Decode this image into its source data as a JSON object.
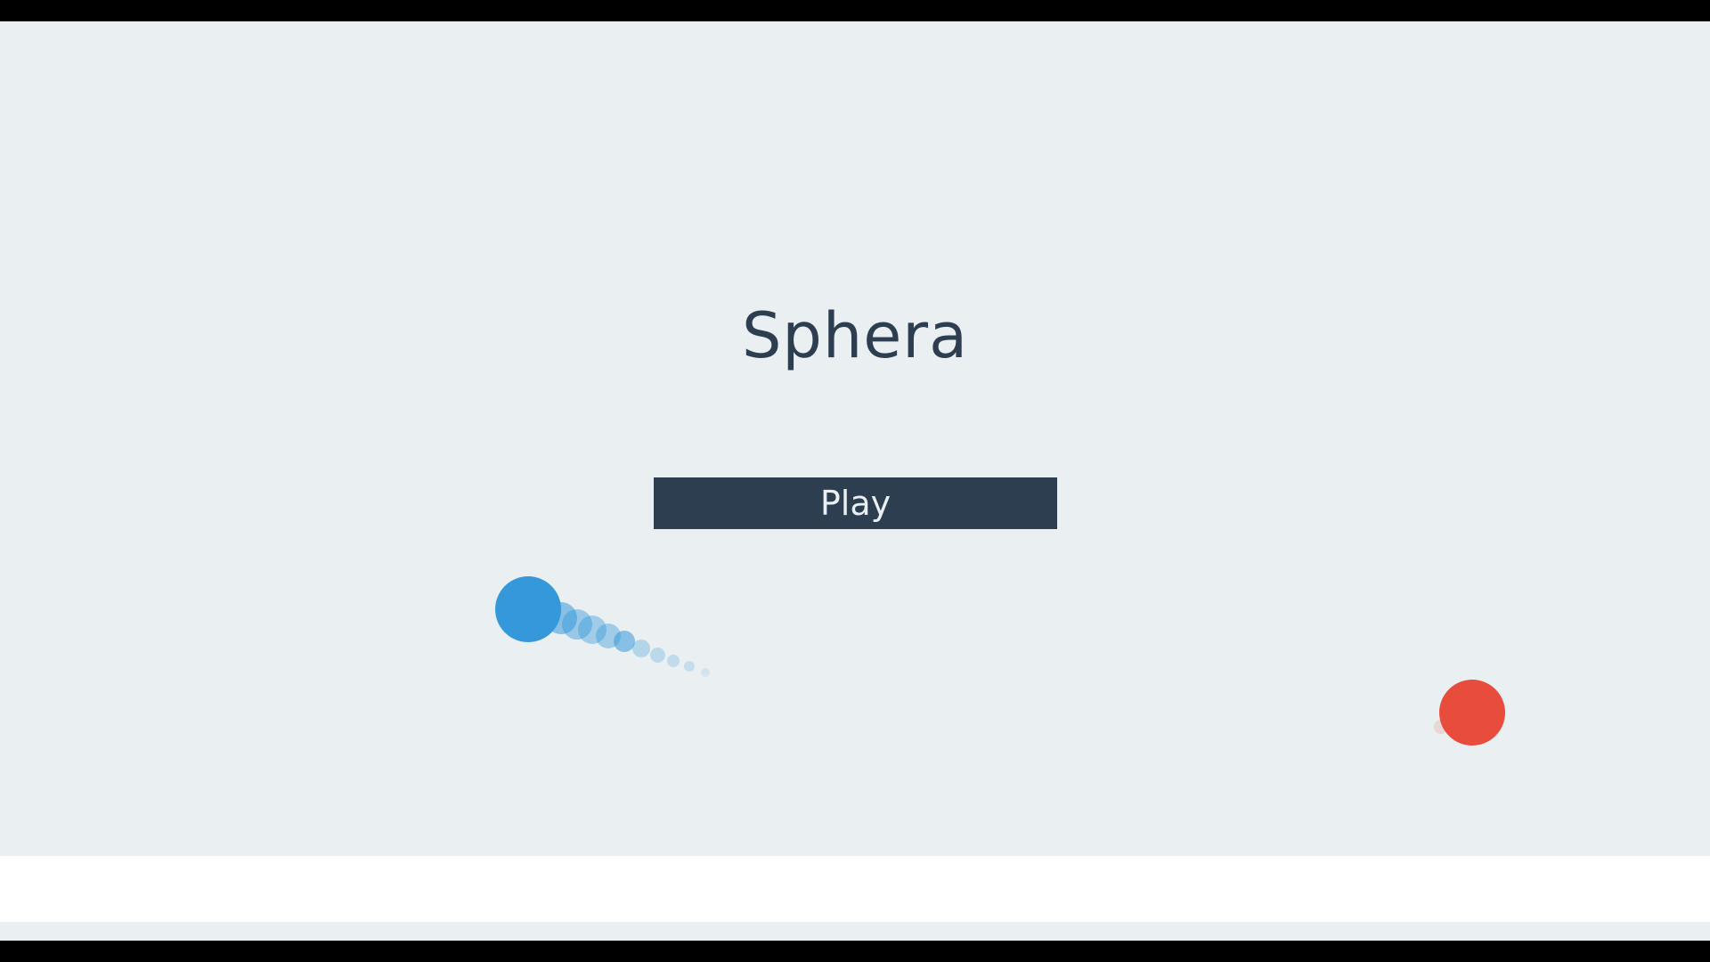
{
  "game": {
    "title": "Sphera",
    "play_label": "Play"
  },
  "colors": {
    "background": "#eaeff1",
    "text_dark": "#2c3e50",
    "button_bg": "#2c3e50",
    "button_text": "#eaeff1",
    "player_ball": "#3498db",
    "enemy_ball": "#e74c3c",
    "frame": "#000000",
    "footer": "#ffffff"
  }
}
